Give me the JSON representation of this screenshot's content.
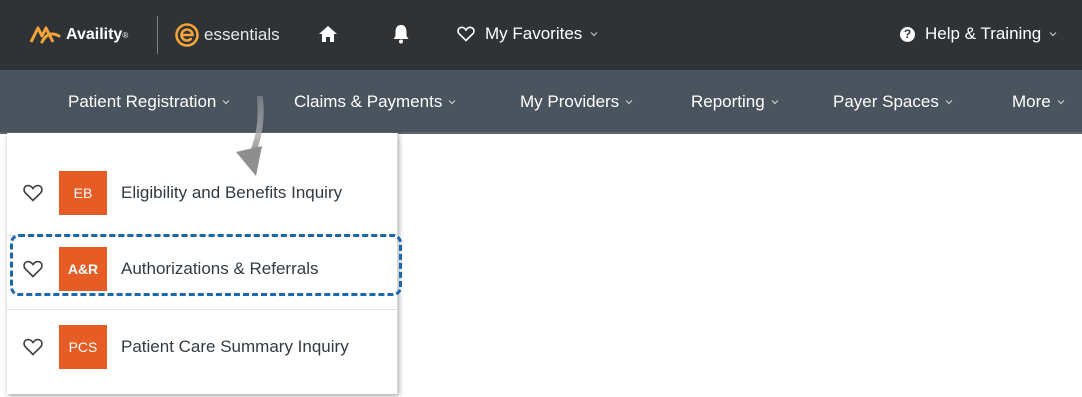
{
  "header": {
    "brand": "Availity",
    "brand_tm": "®",
    "product": "essentials",
    "favorites_label": "My Favorites",
    "help_label": "Help & Training",
    "help_glyph": "?"
  },
  "nav": {
    "items": [
      {
        "label": "Patient Registration"
      },
      {
        "label": "Claims & Payments"
      },
      {
        "label": "My Providers"
      },
      {
        "label": "Reporting"
      },
      {
        "label": "Payer Spaces"
      },
      {
        "label": "More"
      }
    ]
  },
  "dropdown": {
    "items": [
      {
        "badge": "EB",
        "label": "Eligibility and Benefits Inquiry"
      },
      {
        "badge": "A&R",
        "label": "Authorizations & Referrals"
      },
      {
        "badge": "PCS",
        "label": "Patient Care Summary Inquiry"
      }
    ]
  },
  "colors": {
    "topbar": "#2f3336",
    "navbar": "#4a545e",
    "badge": "#e75b25",
    "highlight": "#1a68b0",
    "brand_orange": "#f2a33a"
  },
  "icons": {
    "logo": "availity-logo-icon",
    "essentials": "essentials-logo-icon",
    "home": "home-icon",
    "notifications": "bell-icon",
    "favorites": "heart-icon",
    "help": "question-circle-icon",
    "dropdown_arrow": "chevron-down-icon"
  }
}
